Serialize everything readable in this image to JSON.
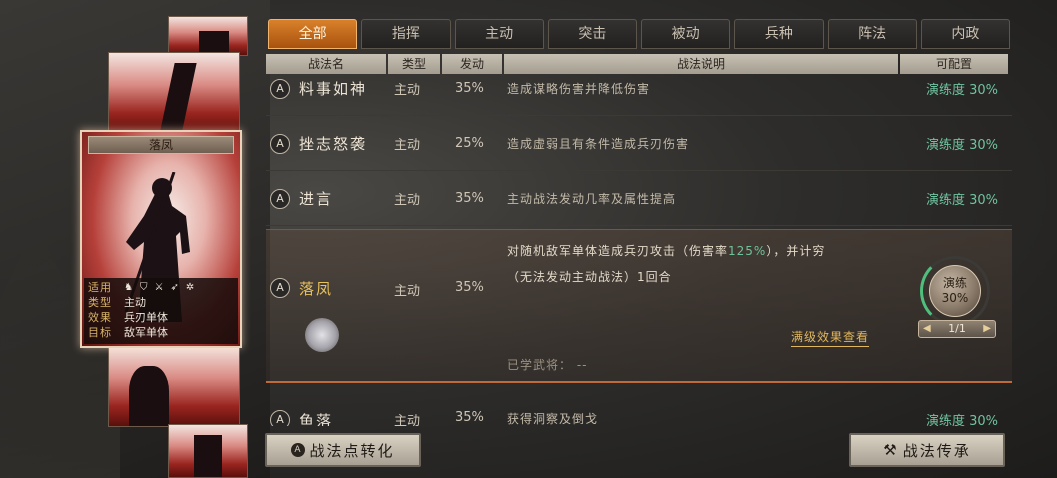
{
  "tabs": [
    {
      "label": "全部",
      "active": true
    },
    {
      "label": "指挥",
      "active": false
    },
    {
      "label": "主动",
      "active": false
    },
    {
      "label": "突击",
      "active": false
    },
    {
      "label": "被动",
      "active": false
    },
    {
      "label": "兵种",
      "active": false
    },
    {
      "label": "阵法",
      "active": false
    },
    {
      "label": "内政",
      "active": false
    }
  ],
  "table_header": {
    "name": "战法名",
    "type": "类型",
    "rate": "发动",
    "desc": "战法说明",
    "config": "可配置"
  },
  "card": {
    "name": "落凤",
    "info": [
      {
        "key": "适用",
        "value": ""
      },
      {
        "key": "类型",
        "value": "主动"
      },
      {
        "key": "效果",
        "value": "兵刃单体"
      },
      {
        "key": "目标",
        "value": "敌军单体"
      }
    ],
    "applicable_icons": [
      "cavalry-icon",
      "shield-icon",
      "spear-icon",
      "archer-icon",
      "wheel-icon"
    ]
  },
  "skills": [
    {
      "badge": "A",
      "name": "料事如神",
      "type": "主动",
      "rate": "35%",
      "desc": "造成谋略伤害并降低伤害",
      "config": "演练度 30%"
    },
    {
      "badge": "A",
      "name": "挫志怒袭",
      "type": "主动",
      "rate": "25%",
      "desc": "造成虚弱且有条件造成兵刃伤害",
      "config": "演练度 30%"
    },
    {
      "badge": "A",
      "name": "进言",
      "type": "主动",
      "rate": "35%",
      "desc": "主动战法发动几率及属性提高",
      "config": "演练度 30%"
    }
  ],
  "expanded": {
    "badge": "A",
    "name": "落凤",
    "type": "主动",
    "rate": "35%",
    "desc_line1_a": "对随机敌军单体造成兵刃攻击（伤害率",
    "desc_line1_hl": "125%",
    "desc_line1_b": "），并计穷",
    "desc_line2": "（无法发动主动战法）1回合",
    "full_effect": "满级效果查看",
    "learned_label": "已学武将：",
    "learned_value": "--",
    "train_label": "演练",
    "train_value": "30%",
    "train_fraction": 0.3,
    "count": "1/1"
  },
  "last_skill": {
    "badge": "A",
    "name": "鱼落",
    "type": "主动",
    "rate": "35%",
    "desc": "获得洞察及倒戈",
    "config": "演练度 30%"
  },
  "buttons": {
    "convert": "战法点转化",
    "convert_icon": "A",
    "inherit": "战法传承"
  }
}
